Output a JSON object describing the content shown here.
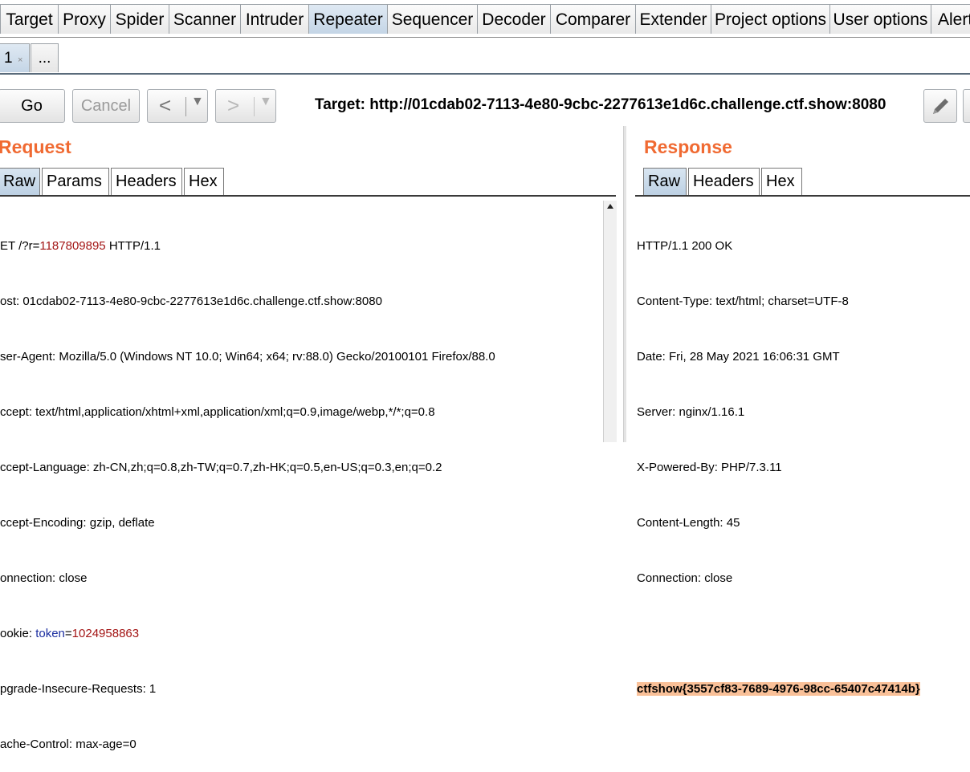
{
  "tabs": [
    "Target",
    "Proxy",
    "Spider",
    "Scanner",
    "Intruder",
    "Repeater",
    "Sequencer",
    "Decoder",
    "Comparer",
    "Extender",
    "Project options",
    "User options",
    "Alerts"
  ],
  "active_tab": "Repeater",
  "subtabs": {
    "first": "1",
    "close": "×",
    "more": "..."
  },
  "toolbar": {
    "go": "Go",
    "cancel": "Cancel",
    "back": "<",
    "forward": ">",
    "dropdown": "▼",
    "target": "Target: http://01cdab02-7113-4e80-9cbc-2277613e1d6c.challenge.ctf.show:8080"
  },
  "request": {
    "title": "Request",
    "tabs": [
      "Raw",
      "Params",
      "Headers",
      "Hex"
    ],
    "line1_prefix": "ET /?r=",
    "line1_value": "1187809895",
    "line1_suffix": " HTTP/1.1",
    "host": "ost: 01cdab02-7113-4e80-9cbc-2277613e1d6c.challenge.ctf.show:8080",
    "user_agent": "ser-Agent: Mozilla/5.0 (Windows NT 10.0; Win64; x64; rv:88.0) Gecko/20100101 Firefox/88.0",
    "accept": "ccept: text/html,application/xhtml+xml,application/xml;q=0.9,image/webp,*/*;q=0.8",
    "accept_language": "ccept-Language: zh-CN,zh;q=0.8,zh-TW;q=0.7,zh-HK;q=0.5,en-US;q=0.3,en;q=0.2",
    "accept_encoding": "ccept-Encoding: gzip, deflate",
    "connection": "onnection: close",
    "cookie_prefix": "ookie: ",
    "cookie_name": "token",
    "cookie_eq": "=",
    "cookie_value": "1024958863",
    "upgrade": "pgrade-Insecure-Requests: 1",
    "cache": "ache-Control: max-age=0"
  },
  "response": {
    "title": "Response",
    "tabs": [
      "Raw",
      "Headers",
      "Hex"
    ],
    "lines": [
      "HTTP/1.1 200 OK",
      "Content-Type: text/html; charset=UTF-8",
      "Date: Fri, 28 May 2021 16:06:31 GMT",
      "Server: nginx/1.16.1",
      "X-Powered-By: PHP/7.3.11",
      "Content-Length: 45",
      "Connection: close"
    ],
    "flag": "ctfshow{3557cf83-7689-4976-98cc-65407c47414b}"
  }
}
